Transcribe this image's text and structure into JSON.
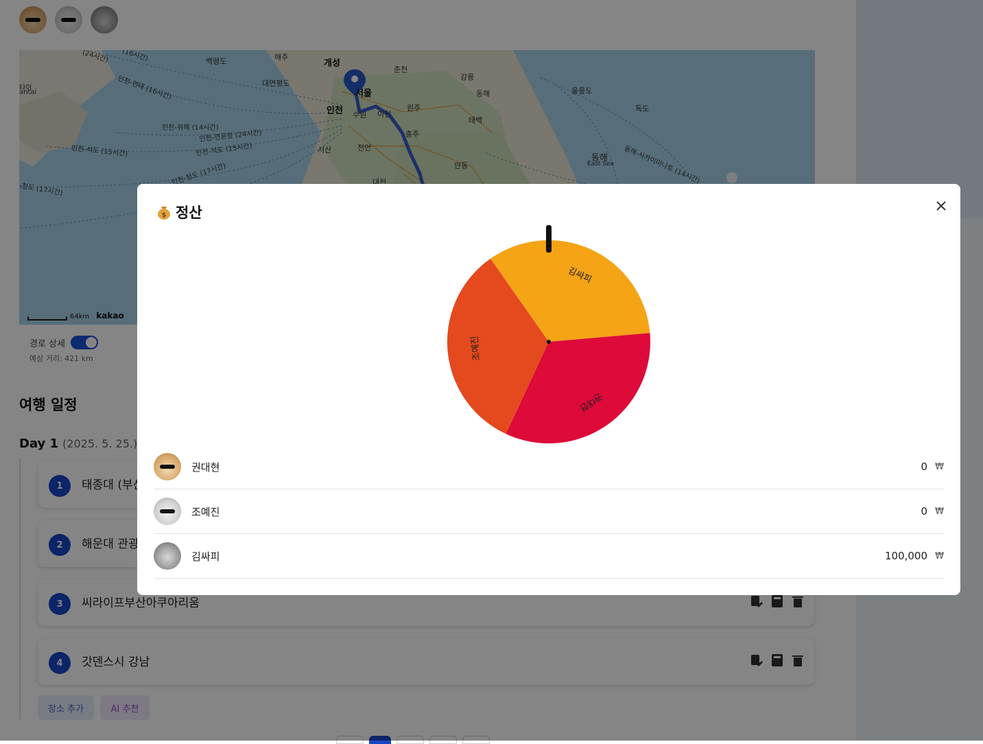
{
  "members": [
    {
      "name": "권대현",
      "avatar": "cat-sunglasses-orange"
    },
    {
      "name": "조예진",
      "avatar": "cat-sunglasses-white"
    },
    {
      "name": "김싸피",
      "avatar": "cat-gray"
    }
  ],
  "map": {
    "attribution": "kakao",
    "scale": "64km",
    "labels": [
      "해주",
      "개성",
      "백령도",
      "춘천",
      "강릉",
      "동해",
      "울릉도",
      "독도",
      "대연평도",
      "서울",
      "인천",
      "수원",
      "이천",
      "원주",
      "충주",
      "태백",
      "서산",
      "천안",
      "안동",
      "대전",
      "동해",
      "East Sea",
      "(24시간)",
      "(16시간)",
      "인천-연태 (16시간)",
      "인천-위해 (14시간)",
      "인천-연운항 (24시간)",
      "인천-석도 (15시간)",
      "인천-석도 (15시간)",
      "인천-청도 (17시간)",
      "-청도 (17시간)",
      "동해-사카이미나토 (14시간)",
      "타이",
      "antai"
    ]
  },
  "route": {
    "toggle_label": "경로 상세",
    "toggle_on": true,
    "distance": "예상 거리: 421 km"
  },
  "itinerary": {
    "title": "여행 일정",
    "day_label": "Day 1",
    "day_date": "(2025. 5. 25.)",
    "places": [
      {
        "num": "1",
        "name": "태종대 (부산"
      },
      {
        "num": "2",
        "name": "해운대 관광"
      },
      {
        "num": "3",
        "name": "씨라이프부산아쿠아리움"
      },
      {
        "num": "4",
        "name": "갓덴스시 강남"
      }
    ],
    "add_button": "장소 추가",
    "ai_button": "AI 추천"
  },
  "modal": {
    "title": "정산",
    "icon": "money-bag-icon",
    "close_icon": "close-icon",
    "settlement": [
      {
        "name": "권대현",
        "amount": "0",
        "currency": "₩"
      },
      {
        "name": "조예진",
        "amount": "0",
        "currency": "₩"
      },
      {
        "name": "김싸피",
        "amount": "100,000",
        "currency": "₩"
      }
    ]
  },
  "wheel": {
    "segments": [
      {
        "name": "김싸피",
        "fraction": 0.3333,
        "color": "#f5a416"
      },
      {
        "name": "권대현",
        "fraction": 0.3333,
        "color": "#dd0a3a"
      },
      {
        "name": "조예진",
        "fraction": 0.3333,
        "color": "#e5491e"
      }
    ]
  },
  "colors": {
    "accent": "#1746c8",
    "overlay": "rgba(0,0,0,0.48)"
  }
}
